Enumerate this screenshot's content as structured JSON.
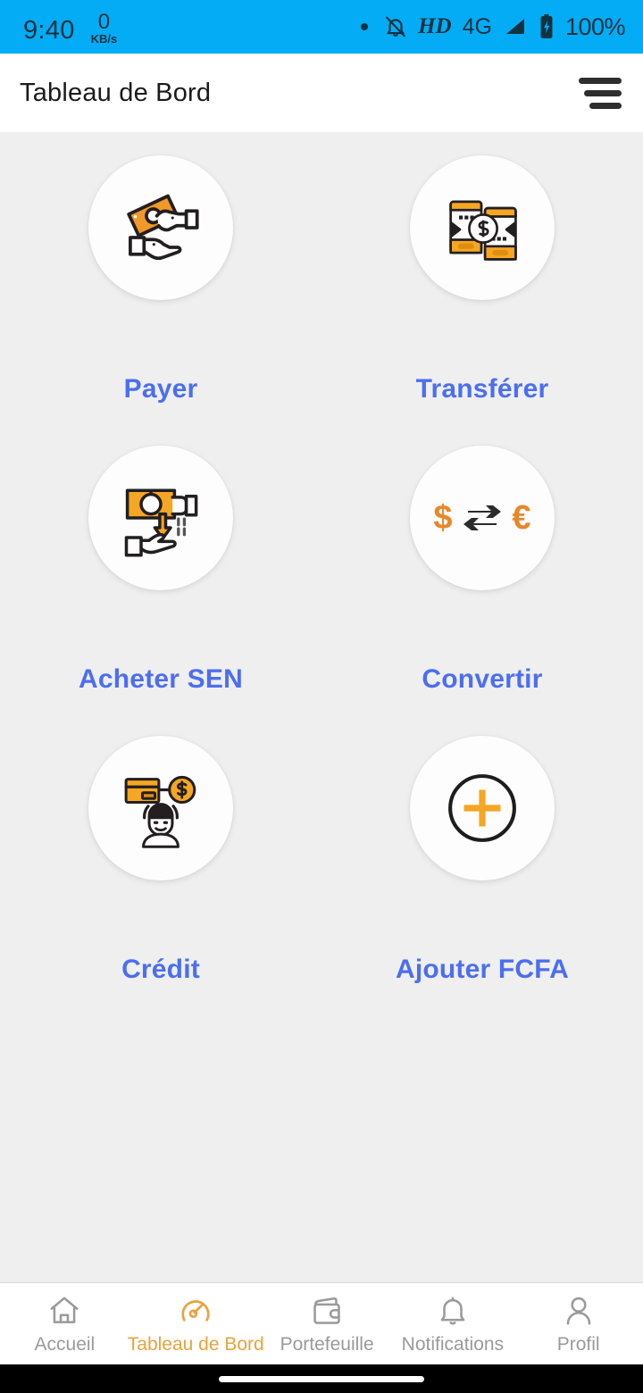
{
  "status_bar": {
    "time": "9:40",
    "net_speed_value": "0",
    "net_speed_unit": "KB/s",
    "hd_label": "HD",
    "network_label": "4G",
    "battery_percent": "100%",
    "background_color": "#03acf5",
    "icons": [
      "dot-indicator",
      "bell-muted-icon",
      "hd-icon",
      "signal-icon",
      "battery-charging-icon"
    ]
  },
  "app_bar": {
    "title": "Tableau de Bord",
    "menu_icon": "hamburger-menu-icon",
    "background_color": "#ffffff"
  },
  "theme": {
    "page_background": "#efefef",
    "tile_background": "#fdfdfd",
    "label_color": "#4c6ef0",
    "accent_orange": "#f5a623",
    "active_nav_color": "#e8a33d",
    "inactive_nav_color": "#9a9a9a"
  },
  "main": {
    "tiles": [
      {
        "label": "Payer",
        "icon": "hands-exchange-money-icon"
      },
      {
        "label": "Transférer",
        "icon": "phone-to-phone-transfer-icon"
      },
      {
        "label": "Acheter SEN",
        "icon": "buy-token-hand-icon"
      },
      {
        "label": "Convertir",
        "icon": "currency-convert-icon"
      },
      {
        "label": "Crédit",
        "icon": "credit-person-card-icon"
      },
      {
        "label": "Ajouter FCFA",
        "icon": "plus-circle-icon"
      }
    ]
  },
  "bottom_nav": {
    "items": [
      {
        "label": "Accueil",
        "icon": "home-icon",
        "active": false
      },
      {
        "label": "Tableau de Bord",
        "icon": "speedometer-icon",
        "active": true
      },
      {
        "label": "Portefeuille",
        "icon": "wallet-icon",
        "active": false
      },
      {
        "label": "Notifications",
        "icon": "bell-icon",
        "active": false
      },
      {
        "label": "Profil",
        "icon": "person-icon",
        "active": false
      }
    ]
  }
}
